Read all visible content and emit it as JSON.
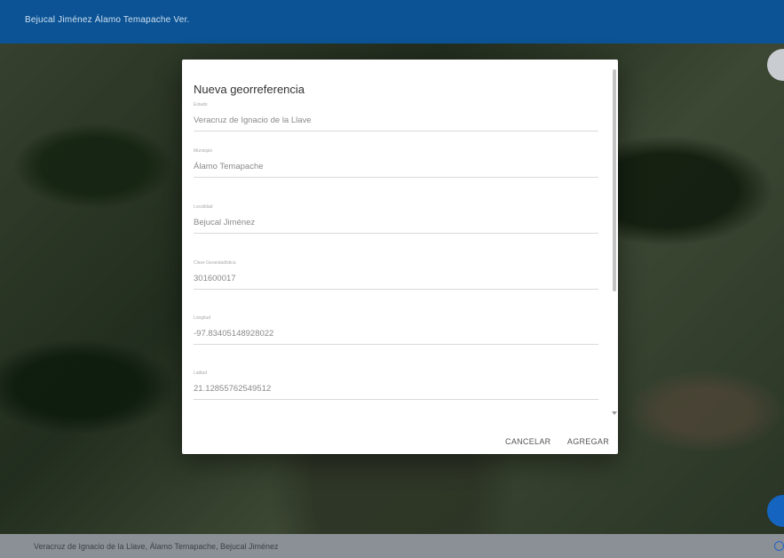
{
  "app": {
    "title": "Bejucal Jiménez Álamo Temapache Ver."
  },
  "dialog": {
    "title": "Nueva georreferencia",
    "fields": [
      {
        "label": "Estado",
        "value": "Veracruz de Ignacio de la Llave"
      },
      {
        "label": "Municipio",
        "value": "Álamo Temapache"
      },
      {
        "label": "Localidad",
        "value": "Bejucal Jiménez"
      },
      {
        "label": "Clave Geoestadística",
        "value": "301600017"
      },
      {
        "label": "Longitud",
        "value": "-97.83405148928022"
      },
      {
        "label": "Latitud",
        "value": "21.12855762549512"
      }
    ],
    "cancel_label": "CANCELAR",
    "add_label": "AGREGAR"
  },
  "footer": {
    "address": "Veracruz de Ignacio de la Llave, Álamo Temapache, Bejucal Jiménez"
  },
  "icons": {
    "info": "info-icon"
  },
  "colors": {
    "header": "#0b5394",
    "fab": "#1565c0"
  }
}
